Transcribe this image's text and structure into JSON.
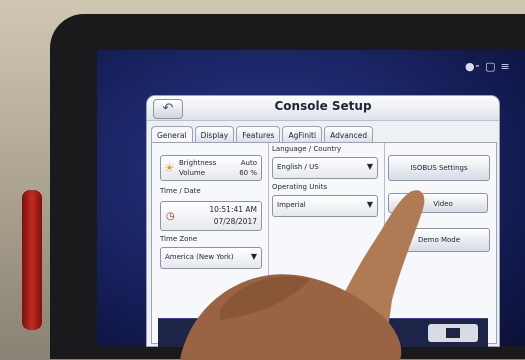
{
  "dialog": {
    "title": "Console Setup",
    "back_icon": "back-arrow-icon"
  },
  "tabs": [
    {
      "label": "General",
      "active": true
    },
    {
      "label": "Display",
      "active": false
    },
    {
      "label": "Features",
      "active": false
    },
    {
      "label": "AgFiniti",
      "active": false
    },
    {
      "label": "Advanced",
      "active": false
    }
  ],
  "brightness": {
    "label": "Brightness",
    "value": "Auto",
    "volume_label": "Volume",
    "volume_value": "60 %",
    "icon": "sun-speaker-icon"
  },
  "time_date": {
    "label": "Time / Date",
    "time": "10:51:41 AM",
    "date": "07/28/2017",
    "icon": "clock-calendar-icon"
  },
  "time_zone": {
    "label": "Time Zone",
    "value": "America (New York)"
  },
  "language": {
    "label": "Language / Country",
    "value": "English / US"
  },
  "units": {
    "label": "Operating Units",
    "value": "Imperial"
  },
  "buttons": {
    "isobus": "ISOBUS Settings",
    "video": "Video",
    "demo": "Demo Mode"
  }
}
